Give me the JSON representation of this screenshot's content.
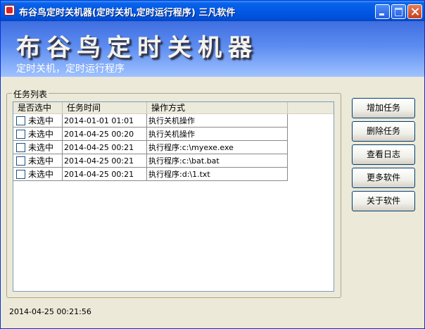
{
  "window": {
    "title": "布谷鸟定时关机器(定时关机,定时运行程序) 三凡软件"
  },
  "banner": {
    "title": "布谷鸟定时关机器",
    "subtitle": "定时关机，定时运行程序"
  },
  "task_list": {
    "label": "任务列表",
    "columns": [
      "是否选中",
      "任务时间",
      "操作方式",
      ""
    ],
    "rows": [
      {
        "checked_label": "未选中",
        "time": "2014-01-01 01:01",
        "action": "执行关机操作"
      },
      {
        "checked_label": "未选中",
        "time": "2014-04-25 00:20",
        "action": "执行关机操作"
      },
      {
        "checked_label": "未选中",
        "time": "2014-04-25 00:21",
        "action": "执行程序:c:\\myexe.exe"
      },
      {
        "checked_label": "未选中",
        "time": "2014-04-25 00:21",
        "action": "执行程序:c:\\bat.bat"
      },
      {
        "checked_label": "未选中",
        "time": "2014-04-25 00:21",
        "action": "执行程序:d:\\1.txt"
      }
    ]
  },
  "buttons": {
    "add": "增加任务",
    "delete": "删除任务",
    "log": "查看日志",
    "more": "更多软件",
    "about": "关于软件"
  },
  "status": {
    "clock": "2014-04-25 00:21:56"
  },
  "colors": {
    "titlebar": "#0058E6",
    "window_bg": "#ECE9D8",
    "banner": "#5c8cf0"
  }
}
